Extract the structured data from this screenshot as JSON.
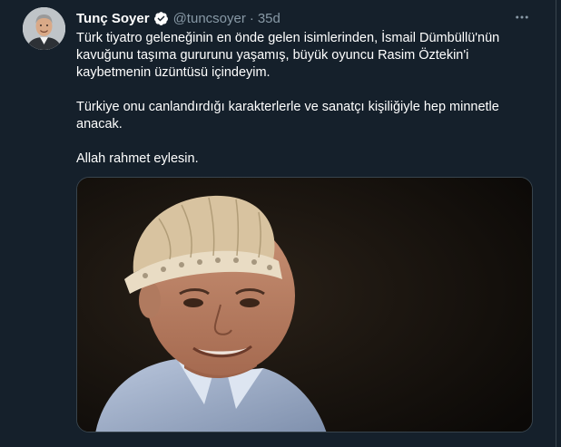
{
  "author": {
    "name": "Tunç Soyer",
    "handle": "@tuncsoyer",
    "separator": "·",
    "time": "35d",
    "verified": true
  },
  "tweet": {
    "lines": [
      "Türk tiyatro geleneğinin en önde gelen isimlerinden, İsmail Dümbüllü'nün",
      "kavuğunu taşıma gururunu yaşamış, büyük oyuncu Rasim Öztekin'i",
      "kaybetmenin üzüntüsü içindeyim.",
      "Türkiye onu canlandırdığı karakterlerle ve sanatçı kişiliğiyle hep minnetle",
      "anacak.",
      "Allah rahmet eylesin."
    ]
  },
  "icons": {
    "more": "more-horizontal-icon",
    "verified": "verified-badge-icon"
  },
  "colors": {
    "background": "#15202b",
    "text_primary": "#ffffff",
    "text_secondary": "#8899a6",
    "verified": "#ffffff",
    "border": "#38444d"
  }
}
